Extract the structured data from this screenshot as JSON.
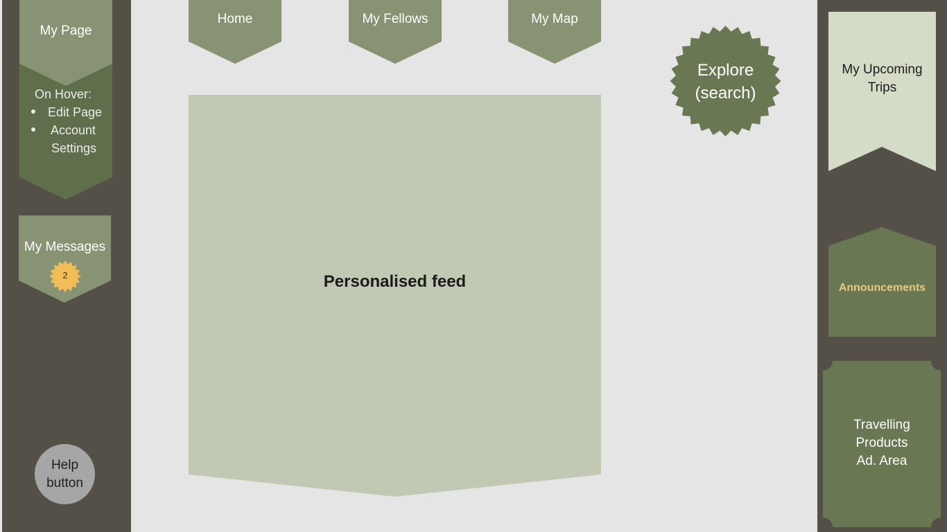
{
  "left_sidebar": {
    "my_page": {
      "label": "My Page",
      "hover_title": "On Hover:",
      "hover_items": [
        "Edit Page",
        "Account",
        "Settings"
      ]
    },
    "my_messages": {
      "label": "My Messages",
      "badge_count": "2"
    },
    "help": {
      "line1": "Help",
      "line2": "button"
    }
  },
  "nav": {
    "tabs": [
      {
        "label": "Home"
      },
      {
        "label": "My Fellows"
      },
      {
        "label": "My Map"
      }
    ]
  },
  "feed": {
    "label": "Personalised feed"
  },
  "explore": {
    "line1": "Explore",
    "line2": "(search)"
  },
  "right_sidebar": {
    "upcoming": {
      "line1": "My Upcoming",
      "line2": "Trips"
    },
    "announcements": {
      "label": "Announcements"
    },
    "ad_area": {
      "line1": "Travelling",
      "line2": "Products",
      "line3": "Ad. Area"
    }
  },
  "colors": {
    "sidebar": "#545048",
    "background": "#e5e5e5",
    "sage_light": "#879372",
    "sage_dark": "#697852",
    "feed_bg": "#c1c9b4",
    "pale_green": "#d4dcc8",
    "badge": "#f1bd58",
    "announcements_text": "#e8c97e",
    "help_button": "#a6a6a6"
  }
}
